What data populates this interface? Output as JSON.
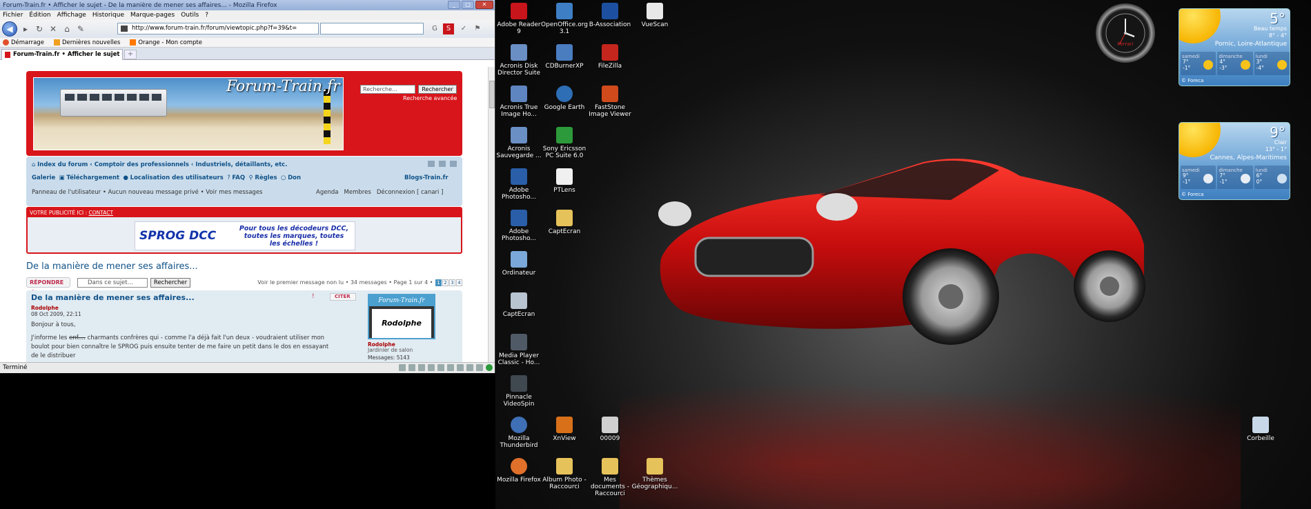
{
  "browser": {
    "window_title": "Forum-Train.fr • Afficher le sujet - De la manière de mener ses affaires... - Mozilla Firefox",
    "menu": [
      "Fichier",
      "Édition",
      "Affichage",
      "Historique",
      "Marque-pages",
      "Outils",
      "?"
    ],
    "url": "http://www.forum-train.fr/forum/viewtopic.php?f=39&t=",
    "bookmarks": [
      "Démarrage",
      "Dernières nouvelles",
      "Orange - Mon compte"
    ],
    "tab_label": "Forum-Train.fr • Afficher le sujet - D...",
    "status": "Terminé"
  },
  "forum": {
    "logo": "Forum-Train.fr",
    "search_placeholder": "Recherche…",
    "search_button": "Rechercher",
    "advanced_search": "Recherche avancée",
    "breadcrumb": "Index du forum ‹ Comptoir des professionnels ‹ Industriels, détaillants, etc.",
    "links": [
      "Galerie",
      "Téléchargement",
      "Localisation des utilisateurs",
      "FAQ",
      "Règles",
      "Don",
      "Blogs-Train.fr"
    ],
    "user_links_left": "Panneau de l'utilisateur • Aucun nouveau message privé • Voir mes messages",
    "user_links_right": [
      "Agenda",
      "Membres",
      "Déconnexion [ canari ]"
    ],
    "ad_header": "VOTRE PUBLICITÉ ICI :",
    "ad_contact": "CONTACT",
    "ad_logo": "SPROG DCC",
    "ad_text": "Pour tous les décodeurs DCC, toutes les marques, toutes les échelles !",
    "topic_title": "De la manière de mener ses affaires...",
    "reply_button": "RÉPONDRE",
    "topic_search_placeholder": "Dans ce sujet…",
    "topic_search_button": "Rechercher",
    "pagination_text": "Voir le premier message non lu • 34 messages • Page 1 sur 4 •",
    "pages": [
      "1",
      "2",
      "3",
      "4"
    ],
    "post": {
      "title": "De la manière de mener ses affaires...",
      "quote_button": "CITER",
      "author": "Rodolphe",
      "date": "08 Oct 2009, 22:11",
      "body_1": "Bonjour à tous,",
      "body_2_a": "J'informe les ",
      "body_2_strike": "enf....",
      "body_2_b": " charmants confrères qui - comme l'a déjà fait l'un deux - voudraient utiliser mon boulot pour bien connaître le SPROG puis ensuite tenter de me faire un petit dans le dos en essayant de le distribuer",
      "avatar_header": "Forum-Train.fr",
      "avatar_name": "Rodolphe",
      "profile_name": "Rodolphe",
      "profile_rank": "Jardinier de salon",
      "profile_msgs": "Messages: 5143"
    }
  },
  "desktop": {
    "icons": [
      {
        "label": "Adobe Reader 9",
        "color": "#c8141b"
      },
      {
        "label": "OpenOffice.org 3.1",
        "color": "#3d7ec4"
      },
      {
        "label": "B-Association",
        "color": "#1d4fa0"
      },
      {
        "label": "VueScan",
        "color": "#e8e8e8"
      },
      {
        "label": "Acronis Disk Director Suite",
        "color": "#6a8fc4"
      },
      {
        "label": "CDBurnerXP",
        "color": "#4a7cc0"
      },
      {
        "label": "FileZilla",
        "color": "#c4261d"
      },
      {
        "label": "Acronis True Image Ho...",
        "color": "#5f85c0"
      },
      {
        "label": "Google Earth",
        "color": "#2d6eb5"
      },
      {
        "label": "FastStone Image Viewer",
        "color": "#d04a1c"
      },
      {
        "label": "Acronis Sauvegarde ...",
        "color": "#6a8fc4"
      },
      {
        "label": "Sony Ericsson PC Suite 6.0",
        "color": "#2c9a3a"
      },
      {
        "label": "Adobe Photosho...",
        "color": "#2a5ea8"
      },
      {
        "label": "PTLens",
        "color": "#f0f0f0"
      },
      {
        "label": "Adobe Photosho...",
        "color": "#2a5ea8"
      },
      {
        "label": "CaptEcran",
        "color": "#e6c25a"
      },
      {
        "label": "Ordinateur",
        "color": "#7aa8d8"
      },
      {
        "label": "CaptEcran",
        "color": "#b8c4d0"
      },
      {
        "label": "Media Player Classic - Ho...",
        "color": "#505a66"
      },
      {
        "label": "Pinnacle VideoSpin",
        "color": "#404850"
      },
      {
        "label": "Mozilla Thunderbird",
        "color": "#3f6fb4"
      },
      {
        "label": "XnView",
        "color": "#d8701a"
      },
      {
        "label": "00009",
        "color": "#d0d0d0"
      },
      {
        "label": "Mozilla Firefox",
        "color": "#e0702a"
      },
      {
        "label": "Album Photo - Raccourci",
        "color": "#e6c25a"
      },
      {
        "label": "Mes documents - Raccourci",
        "color": "#e6c25a"
      },
      {
        "label": "Thèmes Géographiqu...",
        "color": "#e6c25a"
      },
      {
        "label": "Corbeille",
        "color": "#c8d8e8"
      }
    ],
    "clock_brand": "Ferrari",
    "weather": [
      {
        "temp": "5°",
        "condition": "Beau temps",
        "range": "8° - 4°",
        "city": "Pornic, Loire-Atlantique",
        "days": [
          {
            "name": "samedi",
            "temps": "7°\n-1°"
          },
          {
            "name": "dimanche",
            "temps": "4°\n-3°"
          },
          {
            "name": "lundi",
            "temps": "3°\n-4°"
          }
        ],
        "credit": "© Foreca"
      },
      {
        "temp": "9°",
        "condition": "Clair",
        "range": "13° - 1°",
        "city": "Cannes, Alpes-Maritimes",
        "days": [
          {
            "name": "samedi",
            "temps": "9°\n-1°"
          },
          {
            "name": "dimanche",
            "temps": "7°\n-1°"
          },
          {
            "name": "lundi",
            "temps": "6°\n0°"
          }
        ],
        "credit": "© Foreca"
      }
    ]
  }
}
